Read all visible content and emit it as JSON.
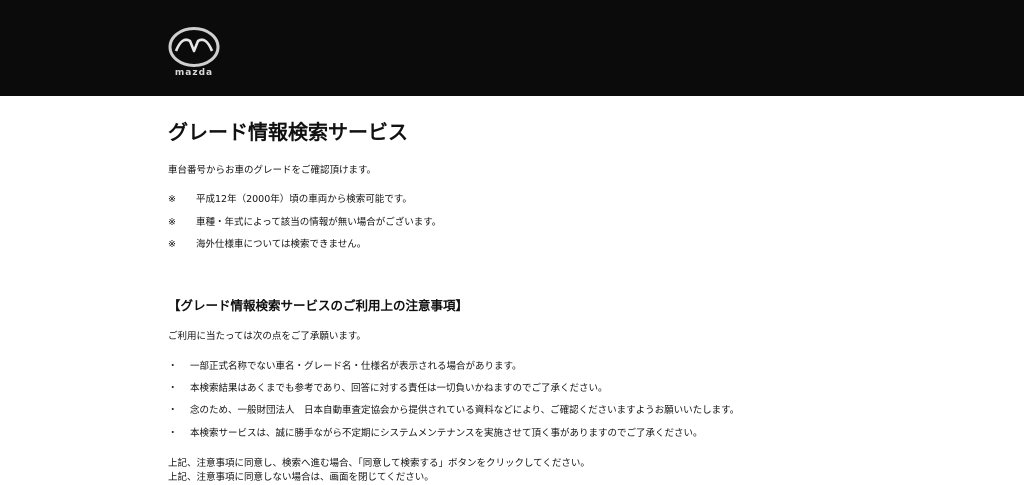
{
  "header": {
    "logo_text": "mazda",
    "logo_alt": "mazda-logo"
  },
  "main": {
    "title": "グレード情報検索サービス",
    "intro": "車台番号からお車のグレードをご確認頂けます。",
    "notes": [
      {
        "mark": "※",
        "text": "平成12年（2000年）頃の車両から検索可能です。"
      },
      {
        "mark": "※",
        "text": "車種・年式によって該当の情報が無い場合がございます。"
      },
      {
        "mark": "※",
        "text": "海外仕様車については検索できません。"
      }
    ],
    "caution_title": "【グレード情報検索サービスのご利用上の注意事項】",
    "caution_intro": "ご利用に当たっては次の点をご了承願います。",
    "caution_items": [
      {
        "bullet": "・",
        "text": "一部正式名称でない車名・グレード名・仕様名が表示される場合があります。"
      },
      {
        "bullet": "・",
        "text": "本検索結果はあくまでも参考であり、回答に対する責任は一切負いかねますのでご了承ください。"
      },
      {
        "bullet": "・",
        "text": "念のため、一般財団法人　日本自動車査定協会から提供されている資料などにより、ご確認くださいますようお願いいたします。"
      },
      {
        "bullet": "・",
        "text": "本検索サービスは、誠に勝手ながら不定期にシステムメンテナンスを実施させて頂く事がありますのでご了承ください。"
      }
    ],
    "footer_lines": [
      "上記、注意事項に同意し、検索へ進む場合、「同意して検索する」ボタンをクリックしてください。",
      "上記、注意事項に同意しない場合は、画面を閉じてください。"
    ]
  },
  "colors": {
    "header_bg": "#0b0b0b",
    "page_bg": "#ffffff",
    "text": "#111111"
  }
}
